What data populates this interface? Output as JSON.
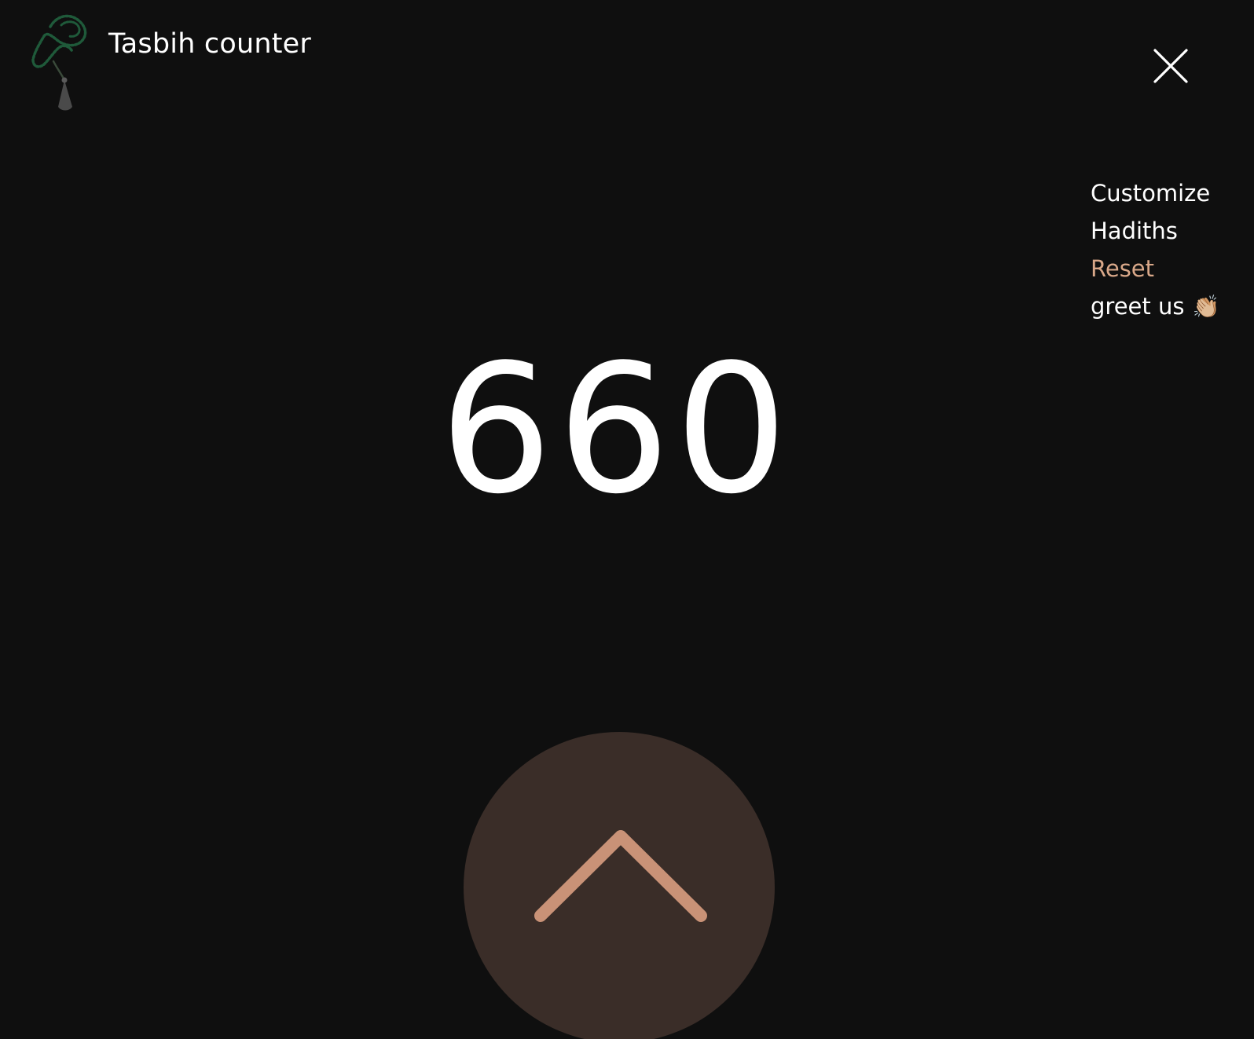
{
  "app": {
    "title": "Tasbih counter",
    "logo_icon": "prayer-beads-icon",
    "close_icon": "close-icon"
  },
  "menu": {
    "items": [
      {
        "label": "Customize"
      },
      {
        "label": "Hadiths"
      },
      {
        "label": "Reset"
      },
      {
        "label": "greet us",
        "emoji": "👏🏼"
      }
    ]
  },
  "counter": {
    "value": "660",
    "increment_icon": "chevron-up-icon"
  },
  "colors": {
    "background": "#0f0f0f",
    "text": "#ffffff",
    "accent": "#d9a889",
    "button_background": "#3a2d28",
    "logo_beads": "#1f5a3a",
    "logo_tassel": "#4a4a4a"
  }
}
